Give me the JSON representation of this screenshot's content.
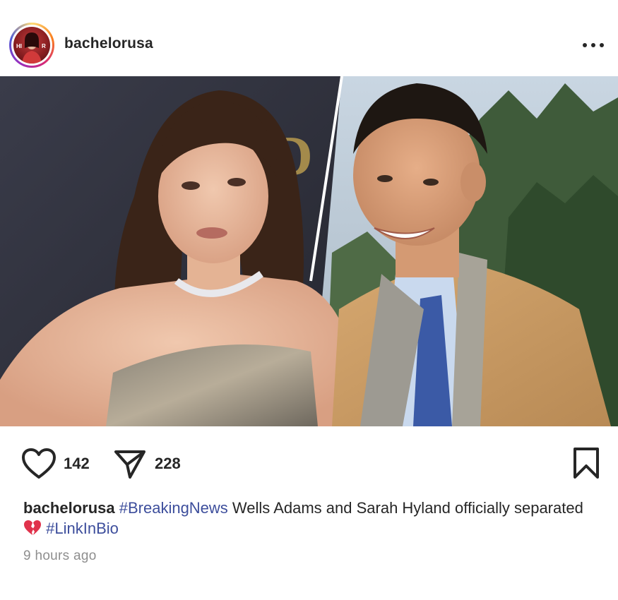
{
  "post": {
    "username": "bachelorusa",
    "avatar_icon": "avatar-photo",
    "more_icon": "more-options-icon",
    "image_icon": "post-photo",
    "likes": "142",
    "shares": "228",
    "caption": {
      "username": "bachelorusa",
      "hashtag1": "#BreakingNews",
      "text1": " Wells Adams and Sarah Hyland officially separated ",
      "emoji": "broken-heart-emoji",
      "hashtag2": "#LinkInBio"
    },
    "timestamp": "9 hours ago"
  },
  "colors": {
    "text": "#262626",
    "hashtag": "#3d4e9c",
    "muted": "#8e8e8e",
    "broken_heart": "#e0324b"
  }
}
